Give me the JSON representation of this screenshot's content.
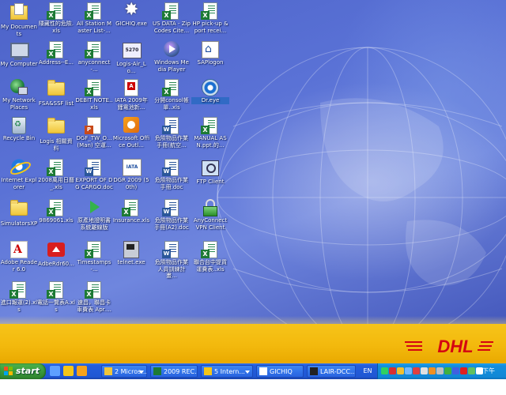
{
  "colors": {
    "wallpaper_blue": "#5a72d6",
    "dhl_yellow": "#f3b90d",
    "dhl_red": "#d40511",
    "taskbar_blue": "#245edc",
    "start_green": "#3a9a3a",
    "tray_blue": "#1188d6"
  },
  "wallpaper": {
    "logo_text": "DHL"
  },
  "desktop_icons": [
    {
      "label": "My Documents",
      "icon": "my-documents-icon"
    },
    {
      "label": "隱藏性的危險.xls",
      "icon": "excel-file-icon"
    },
    {
      "label": "All Station Master List-...",
      "icon": "excel-file-icon"
    },
    {
      "label": "GICHIQ.exe",
      "icon": "gichiq-exe-icon"
    },
    {
      "label": "US DATA - Zip Codes Cite...",
      "icon": "excel-file-icon"
    },
    {
      "label": "HP pick-up & port recei...",
      "icon": "excel-file-icon"
    },
    {
      "label": "My Computer",
      "icon": "my-computer-icon"
    },
    {
      "label": "Address--E...",
      "icon": "excel-file-icon"
    },
    {
      "label": "anyconnect-...",
      "icon": "excel-file-icon"
    },
    {
      "label": "Logis-Air_Lo...",
      "icon": "ibm-5270-icon"
    },
    {
      "label": "Windows Media Player",
      "icon": "windows-media-player-icon"
    },
    {
      "label": "SAPlogon",
      "icon": "saplogon-icon"
    },
    {
      "label": "My Network Places",
      "icon": "my-network-places-icon"
    },
    {
      "label": "FSA&SSF list",
      "icon": "folder-icon"
    },
    {
      "label": "DEBIT NOTE..xls",
      "icon": "excel-file-icon"
    },
    {
      "label": "IATA 2009年鋰電池新...",
      "icon": "pdf-file-icon"
    },
    {
      "label": "分開consol帳單..xls",
      "icon": "excel-file-icon"
    },
    {
      "label": "Dr.eye",
      "icon": "dr-eye-icon"
    },
    {
      "label": "Recycle Bin",
      "icon": "recycle-bin-icon"
    },
    {
      "label": "Logis 相關資料",
      "icon": "folder-icon"
    },
    {
      "label": "DGF_TW_O... (Man) 空運...",
      "icon": "powerpoint-file-icon"
    },
    {
      "label": "Microsoft Office Outl...",
      "icon": "microsoft-office-outlook-icon"
    },
    {
      "label": "危險物品作業手冊(航空...",
      "icon": "word-file-icon"
    },
    {
      "label": "MANUAL ASN.ppt.的...",
      "icon": "excel-file-icon"
    },
    {
      "label": "Internet Explorer",
      "icon": "internet-explorer-icon"
    },
    {
      "label": "2008萬用日曆_.xls",
      "icon": "excel-file-icon"
    },
    {
      "label": "EXPORT OF DG CARGO.doc",
      "icon": "word-file-icon"
    },
    {
      "label": "DGR 2009 (50th)",
      "icon": "iata-dgr-icon"
    },
    {
      "label": "危險物品作業手冊.doc",
      "icon": "word-file-icon"
    },
    {
      "label": "FTP Client",
      "icon": "ftp-client-icon"
    },
    {
      "label": "SimulatorsXP",
      "icon": "folder-icon"
    },
    {
      "label": "9869061.xls",
      "icon": "excel-file-icon"
    },
    {
      "label": "原產地證明書系統離線版",
      "icon": "green-arrow-icon"
    },
    {
      "label": "Insurance.xls",
      "icon": "excel-file-icon"
    },
    {
      "label": "危險物品作業手冊(A2).doc",
      "icon": "word-file-icon"
    },
    {
      "label": "AnyConnect VPN Client",
      "icon": "lock-icon"
    },
    {
      "label": "Adobe Reader 6.0",
      "icon": "adobe-reader-icon"
    },
    {
      "label": "AdbeRdr60...",
      "icon": "adberdr-installer-icon"
    },
    {
      "label": "Timestamps-...",
      "icon": "excel-file-icon"
    },
    {
      "label": "telnet.exe",
      "icon": "telnet-icon"
    },
    {
      "label": "危險物品作業人員訓練計畫...",
      "icon": "word-file-icon"
    },
    {
      "label": "聯合台中提貨運費表..xls",
      "icon": "excel-file-icon"
    },
    {
      "label": "進口報運(2).xls",
      "icon": "excel-file-icon"
    },
    {
      "label": "電話一覽表A.xls",
      "icon": "excel-file-icon"
    },
    {
      "label": "速昌，聯昌卡車費表 Apr....",
      "icon": "excel-file-icon"
    }
  ],
  "taskbar": {
    "start_label": "start",
    "quick_launch": [
      {
        "icon": "show-desktop-icon",
        "color": "#5ea0ff"
      },
      {
        "icon": "internet-explorer-icon",
        "color": "#f5c518"
      },
      {
        "icon": "outlook-icon",
        "color": "#f7a21b"
      }
    ],
    "tasks": [
      {
        "label": "2 Micros...",
        "icon": "folder-icon",
        "has_arrow": true
      },
      {
        "label": "2009 REC...",
        "icon": "excel-file-icon",
        "has_arrow": false
      },
      {
        "label": "5 Intern...",
        "icon": "internet-explorer-icon",
        "has_arrow": true
      },
      {
        "label": "GICHIQ",
        "icon": "gichiq-exe-icon",
        "has_arrow": false
      },
      {
        "label": "LAIR-DCC...",
        "icon": "terminal-icon",
        "has_arrow": false
      }
    ],
    "language": "EN",
    "tray_icons": [
      {
        "icon": "tray-network-icon",
        "color": "#2fd060"
      },
      {
        "icon": "tray-shield-icon",
        "color": "#d83030"
      },
      {
        "icon": "tray-antivirus-icon",
        "color": "#f0c030"
      },
      {
        "icon": "tray-dr-eye-icon",
        "color": "#70b8ff"
      },
      {
        "icon": "tray-ime-icon",
        "color": "#e04040"
      },
      {
        "icon": "tray-lock-icon",
        "color": "#e0e0e0"
      },
      {
        "icon": "tray-printer-icon",
        "color": "#f09020"
      },
      {
        "icon": "tray-volume-icon",
        "color": "#c0c0c0"
      },
      {
        "icon": "tray-vpn-icon",
        "color": "#40b040"
      },
      {
        "icon": "tray-sap-icon",
        "color": "#4060e0"
      },
      {
        "icon": "tray-security-icon",
        "color": "#e02020"
      },
      {
        "icon": "tray-battery-icon",
        "color": "#60c060"
      },
      {
        "icon": "tray-v-icon",
        "color": "#ffffff"
      }
    ],
    "clock": "下午 12:28"
  }
}
